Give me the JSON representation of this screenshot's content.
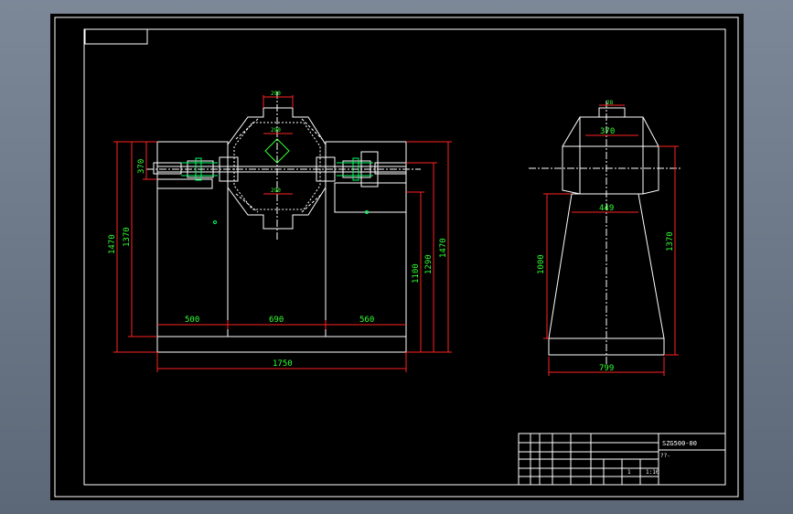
{
  "drawing": {
    "number": "SZG500-00",
    "sub_label": "??-",
    "colors": {
      "background": "#000000",
      "line": "#ffffff",
      "dimension": "#ff2222",
      "dim_text": "#33ff33",
      "center": "#ffffff",
      "accent": "#00ff66",
      "frame_outer": "#6d7988"
    }
  },
  "front_view": {
    "dims": {
      "top_width": "290",
      "inner_top": "290",
      "inner_mid": "290",
      "left_height_a": "370",
      "left_height_b": "1370",
      "left_total": "1470",
      "right_a": "1100",
      "right_b": "1290",
      "right_total": "1470",
      "seg_left": "500",
      "seg_mid": "690",
      "seg_right": "560",
      "overall": "1750"
    }
  },
  "side_view": {
    "dims": {
      "top_small": "28",
      "top_width": "370",
      "mid_width": "449",
      "left_height": "1000",
      "right_height": "1370",
      "base_width": "799"
    }
  },
  "title_block": {
    "scale": "1:10",
    "qty": "1"
  }
}
